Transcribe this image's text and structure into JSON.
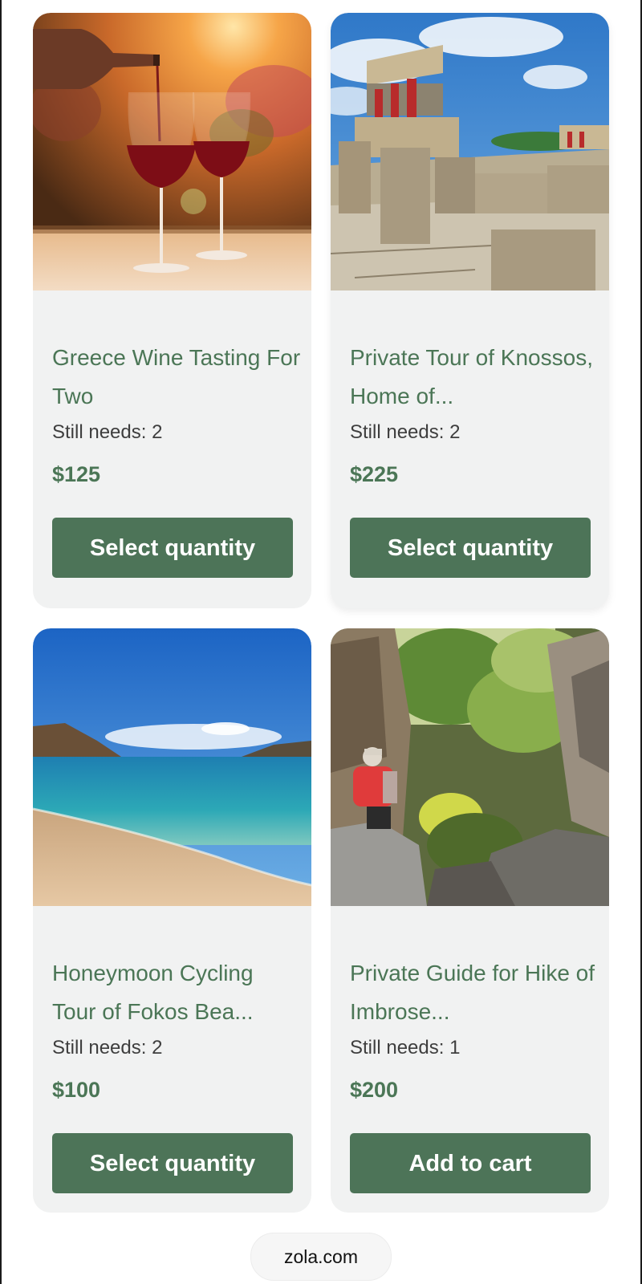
{
  "products": [
    {
      "title": "Greece Wine Tasting For Two",
      "image": "wine-glasses-sunset-photo",
      "still_needs": "Still needs: 2",
      "price": "$125",
      "button_label": "Select quantity"
    },
    {
      "title": "Private Tour of Knossos, Home of...",
      "image": "knossos-ruins-photo",
      "still_needs": "Still needs: 2",
      "price": "$225",
      "button_label": "Select quantity"
    },
    {
      "title": "Honeymoon Cycling Tour of Fokos Bea...",
      "image": "beach-sea-photo",
      "still_needs": "Still needs: 2",
      "price": "$100",
      "button_label": "Select quantity"
    },
    {
      "title": "Private Guide for Hike of Imbrose...",
      "image": "gorge-hiker-photo",
      "still_needs": "Still needs: 1",
      "price": "$200",
      "button_label": "Add to cart"
    }
  ],
  "browser": {
    "url": "zola.com"
  },
  "colors": {
    "accent_green": "#4d7458",
    "title_green": "#4b7656",
    "card_background": "#f1f2f2"
  }
}
